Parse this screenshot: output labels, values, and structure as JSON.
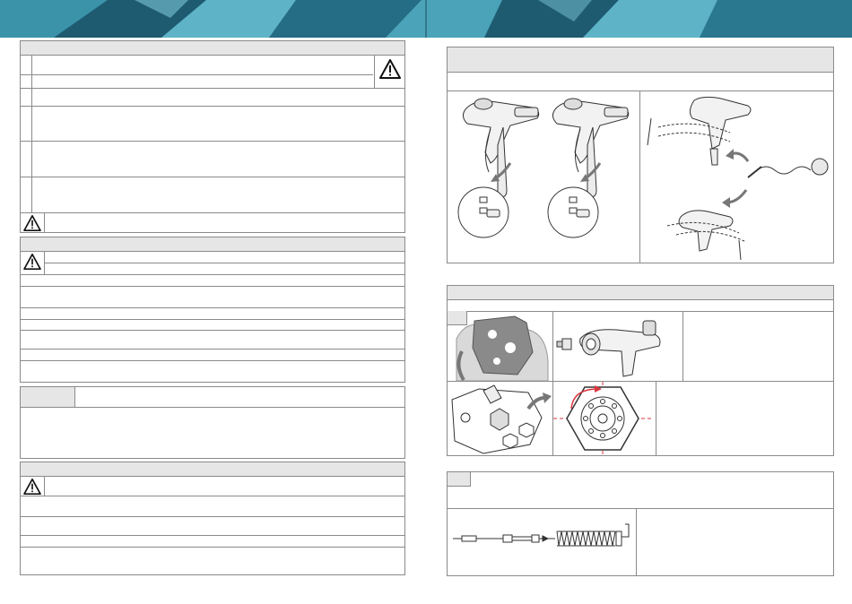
{
  "header": {
    "colors": {
      "base": "#2d7f95",
      "light": "#5fb3c6",
      "dark": "#1e5b70"
    }
  },
  "icons": {
    "warning": "warning-triangle-icon",
    "arrow": "curved-arrow-icon",
    "spray_gun": "spray-gun-illustration",
    "wrench": "multi-tool-wrench-illustration",
    "nozzle": "nozzle-front-view-illustration",
    "spring": "cleaning-spring-illustration"
  },
  "colors": {
    "border": "#8a8a8a",
    "bar": "#e6e6e6",
    "accent_red": "#d9363e",
    "line": "#333333"
  }
}
